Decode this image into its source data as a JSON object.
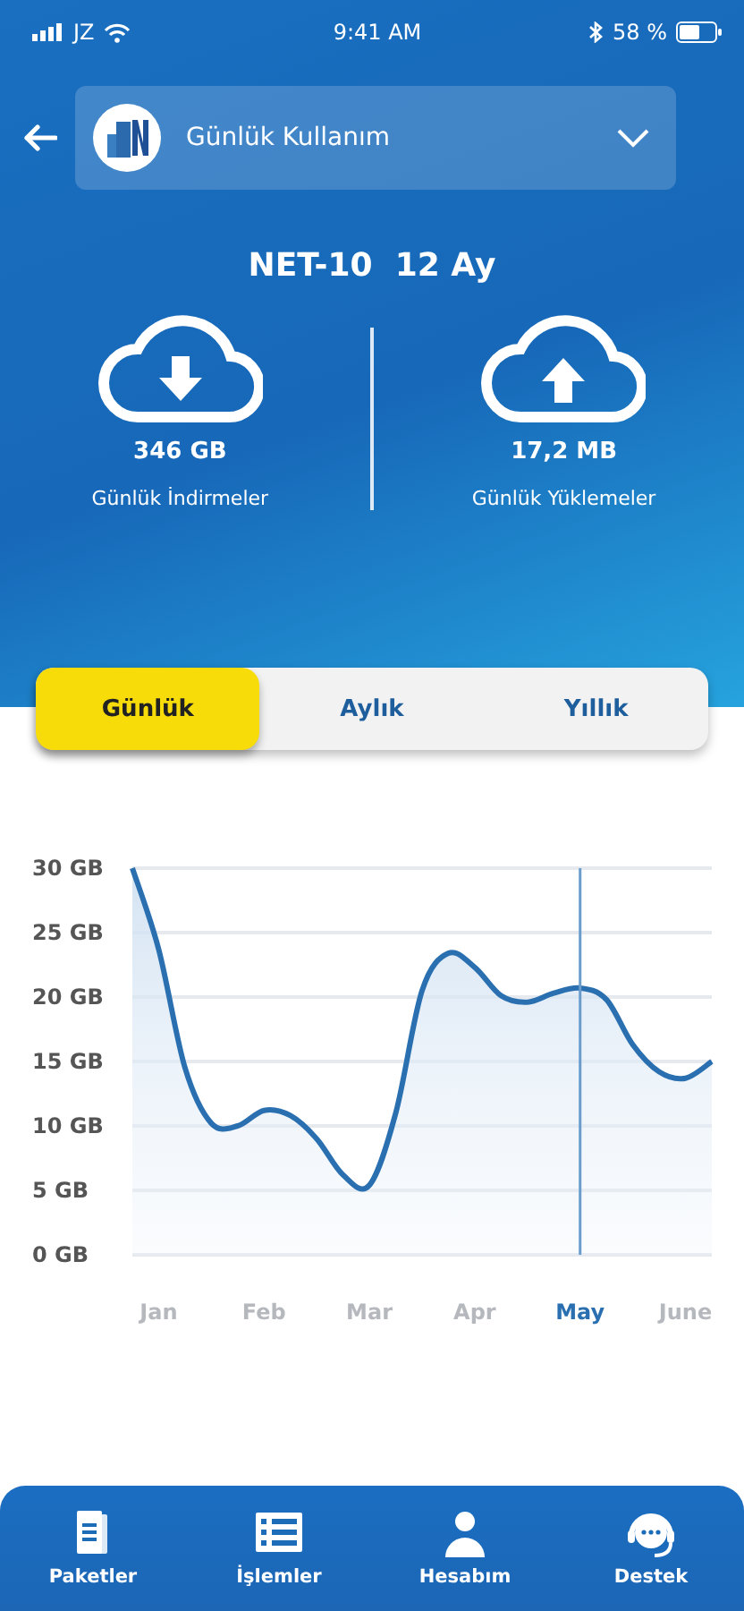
{
  "status_bar": {
    "carrier": "JZ",
    "time": "9:41 AM",
    "battery": "58 %"
  },
  "header": {
    "selector": {
      "label": "Günlük Kullanım"
    }
  },
  "package": {
    "name": "NET-10",
    "duration": "12 Ay"
  },
  "stats": [
    {
      "kind": "download",
      "value": "346 GB",
      "label": "Günlük İndirmeler"
    },
    {
      "kind": "upload",
      "value": "17,2 MB",
      "label": "Günlük Yüklemeler"
    }
  ],
  "tabs": [
    {
      "label": "Günlük",
      "selected": true
    },
    {
      "label": "Aylık",
      "selected": false
    },
    {
      "label": "Yıllık",
      "selected": false
    }
  ],
  "chart": {
    "chart_data": {
      "type": "area",
      "grid": true,
      "categories": [
        null,
        "Jan",
        null,
        null,
        null,
        "Feb",
        null,
        null,
        null,
        "Mar",
        null,
        null,
        null,
        "Apr",
        null,
        null,
        null,
        "May",
        null,
        null,
        null,
        "June",
        null
      ],
      "series": [
        {
          "color": "#2a6fb0",
          "values": [
            30,
            23.7,
            14.5,
            10.2,
            10,
            11.2,
            10.8,
            9,
            6.2,
            5.4,
            11,
            20.5,
            23.4,
            22.3,
            20.1,
            19.6,
            20.3,
            20.7,
            19.8,
            16.3,
            14.2,
            13.7,
            15
          ]
        }
      ],
      "ylim": [
        0,
        30
      ],
      "yticks": [
        {
          "value": 0,
          "label": "0 GB"
        },
        {
          "value": 5,
          "label": "5 GB"
        },
        {
          "value": 10,
          "label": "10 GB"
        },
        {
          "value": 15,
          "label": "15 GB"
        },
        {
          "value": 20,
          "label": "20 GB"
        },
        {
          "value": 25,
          "label": "25 GB"
        },
        {
          "value": 30,
          "label": "30 GB"
        }
      ],
      "ref_lines": [
        {
          "axis": "x",
          "value": "May"
        }
      ]
    }
  },
  "nav": [
    {
      "kind": "packages",
      "label": "Paketler"
    },
    {
      "kind": "transactions",
      "label": "İşlemler"
    },
    {
      "kind": "account",
      "label": "Hesabım"
    },
    {
      "kind": "support",
      "label": "Destek"
    }
  ]
}
